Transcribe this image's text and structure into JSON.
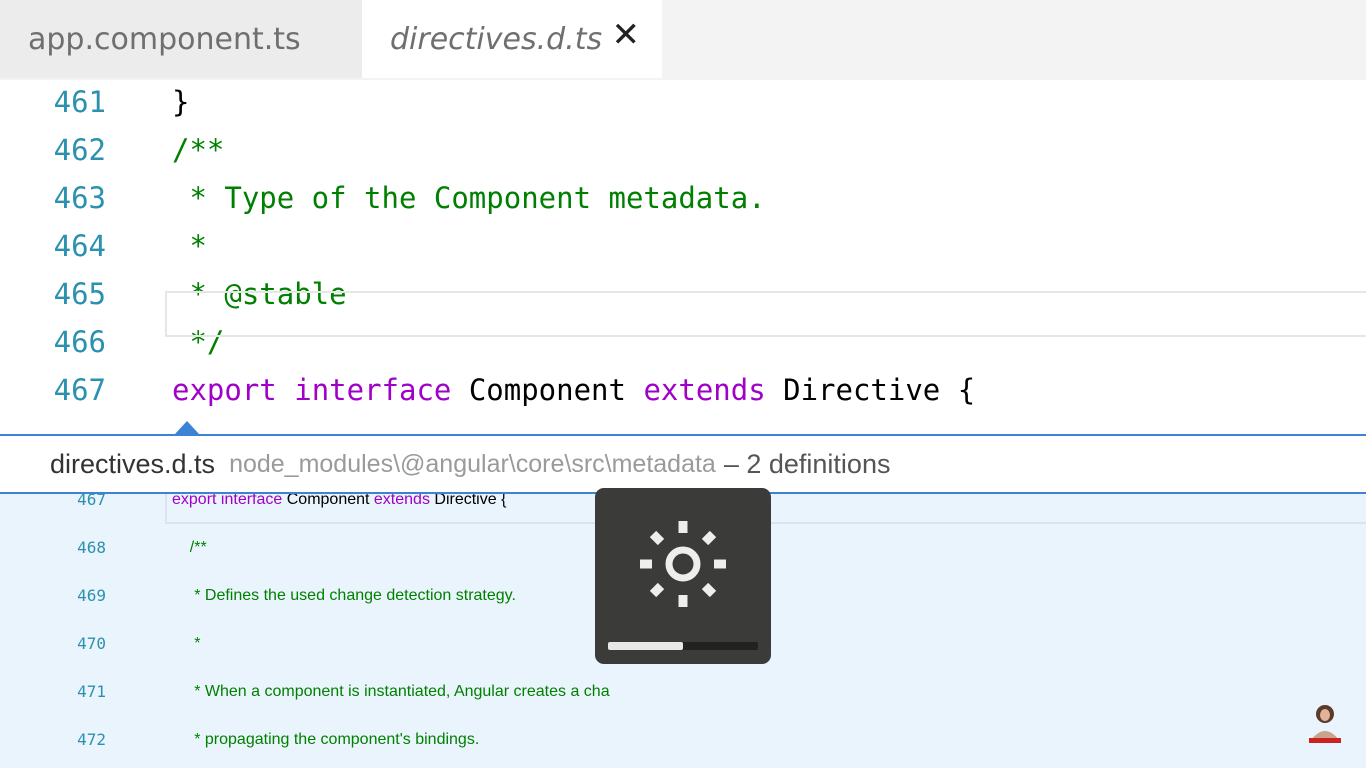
{
  "tabs": [
    {
      "label": "app.component.ts",
      "active": false
    },
    {
      "label": "directives.d.ts",
      "active": true,
      "close_icon": "close-icon"
    }
  ],
  "editor": {
    "lines": [
      {
        "num": "461",
        "segments": [
          {
            "t": "}",
            "c": "pl"
          }
        ]
      },
      {
        "num": "462",
        "segments": [
          {
            "t": "/**",
            "c": "cm"
          }
        ]
      },
      {
        "num": "463",
        "segments": [
          {
            "t": " * Type of the Component metadata.",
            "c": "cm"
          }
        ]
      },
      {
        "num": "464",
        "segments": [
          {
            "t": " *",
            "c": "cm"
          }
        ]
      },
      {
        "num": "465",
        "segments": [
          {
            "t": " * @stable",
            "c": "cm"
          }
        ]
      },
      {
        "num": "466",
        "segments": [
          {
            "t": " */",
            "c": "cm"
          }
        ]
      },
      {
        "num": "467",
        "segments": [
          {
            "t": "export",
            "c": "kw"
          },
          {
            "t": " ",
            "c": "pl"
          },
          {
            "t": "interface",
            "c": "kw"
          },
          {
            "t": " Component ",
            "c": "pl"
          },
          {
            "t": "extends",
            "c": "kw"
          },
          {
            "t": " Directive {",
            "c": "pl"
          }
        ]
      }
    ]
  },
  "peek": {
    "file": "directives.d.ts",
    "path": "node_modules\\@angular\\core\\src\\metadata",
    "definitions": "– 2 definitions",
    "lines": [
      {
        "num": "467",
        "segments": [
          {
            "t": "export",
            "c": "kw"
          },
          {
            "t": " ",
            "c": "pl"
          },
          {
            "t": "interface",
            "c": "kw"
          },
          {
            "t": " Component ",
            "c": "pl"
          },
          {
            "t": "extends",
            "c": "kw"
          },
          {
            "t": " Directive {",
            "c": "pl"
          }
        ]
      },
      {
        "num": "468",
        "segments": [
          {
            "t": "    /**",
            "c": "cm"
          }
        ]
      },
      {
        "num": "469",
        "segments": [
          {
            "t": "     * Defines the used change detection strategy.",
            "c": "cm"
          }
        ]
      },
      {
        "num": "470",
        "segments": [
          {
            "t": "     *",
            "c": "cm"
          }
        ]
      },
      {
        "num": "471",
        "segments": [
          {
            "t": "     * When a component is instantiated, Angular creates a cha",
            "c": "cm"
          }
        ]
      },
      {
        "num": "472",
        "segments": [
          {
            "t": "     * propagating the component's bindings.",
            "c": "cm"
          }
        ]
      }
    ]
  },
  "osd": {
    "icon": "brightness-icon",
    "level": 0.5
  },
  "colors": {
    "line_number": "#2b91af",
    "comment": "#008000",
    "keyword": "#a000c8",
    "peek_border": "#3c83d6",
    "peek_background": "#eaf4fc"
  }
}
